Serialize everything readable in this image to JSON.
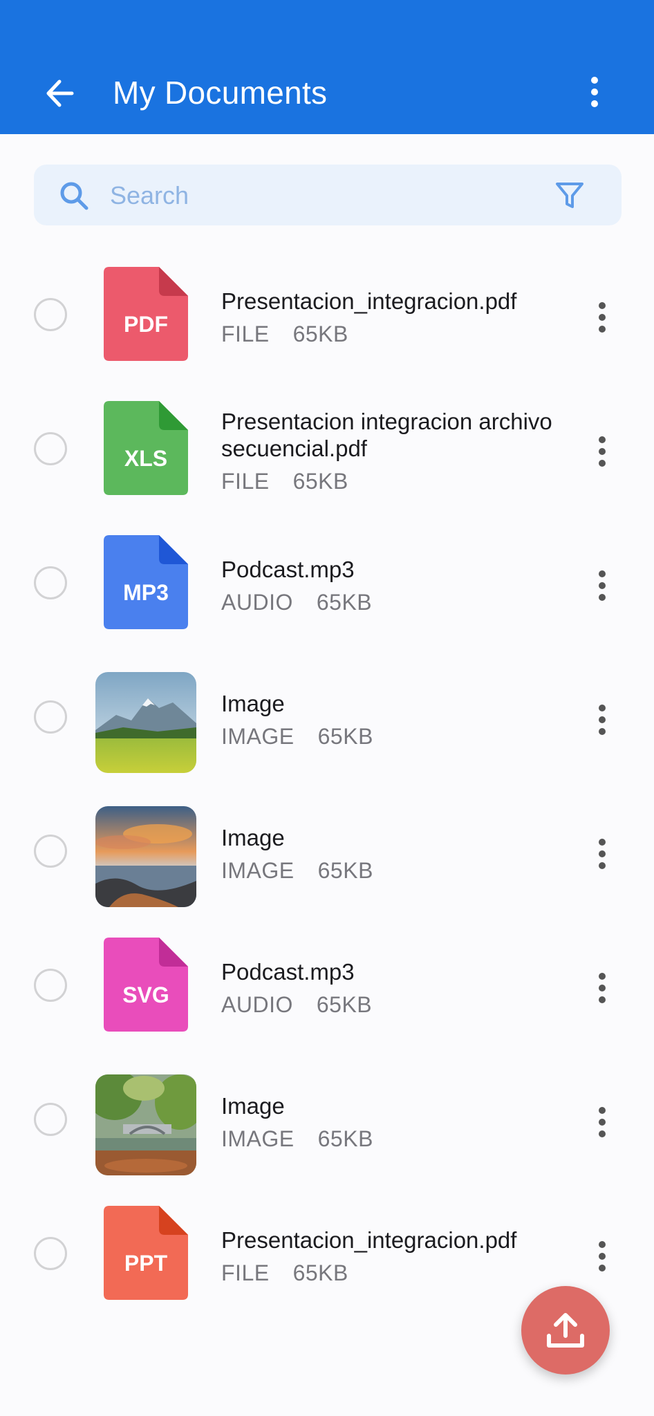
{
  "header": {
    "title": "My Documents"
  },
  "search": {
    "placeholder": "Search"
  },
  "files": [
    {
      "name": "Presentacion_integracion.pdf",
      "type": "FILE",
      "size": "65KB",
      "icon": "pdf-file-icon",
      "badge": "PDF",
      "color": "#ec5a6c",
      "fold": "#c63a4c"
    },
    {
      "name": "Presentacion integracion archivo secuencial.pdf",
      "type": "FILE",
      "size": "65KB",
      "icon": "xls-file-icon",
      "badge": "XLS",
      "color": "#5cb85c",
      "fold": "#2f9a35"
    },
    {
      "name": "Podcast.mp3",
      "type": "AUDIO",
      "size": "65KB",
      "icon": "mp3-file-icon",
      "badge": "MP3",
      "color": "#4a80ee",
      "fold": "#1f57d6"
    },
    {
      "name": "Image",
      "type": "IMAGE",
      "size": "65KB",
      "icon": "mountain-meadow-photo"
    },
    {
      "name": "Image",
      "type": "IMAGE",
      "size": "65KB",
      "icon": "seaside-sunset-photo"
    },
    {
      "name": "Podcast.mp3",
      "type": "AUDIO",
      "size": "65KB",
      "icon": "svg-file-icon",
      "badge": "SVG",
      "color": "#e94dbb",
      "fold": "#c12d97"
    },
    {
      "name": "Image",
      "type": "IMAGE",
      "size": "65KB",
      "icon": "garden-bridge-photo"
    },
    {
      "name": "Presentacion_integracion.pdf",
      "type": "FILE",
      "size": "65KB",
      "icon": "ppt-file-icon",
      "badge": "PPT",
      "color": "#f26a55",
      "fold": "#d6421f"
    }
  ],
  "colors": {
    "appbar": "#1a73e0",
    "fab": "#dd6b66"
  }
}
